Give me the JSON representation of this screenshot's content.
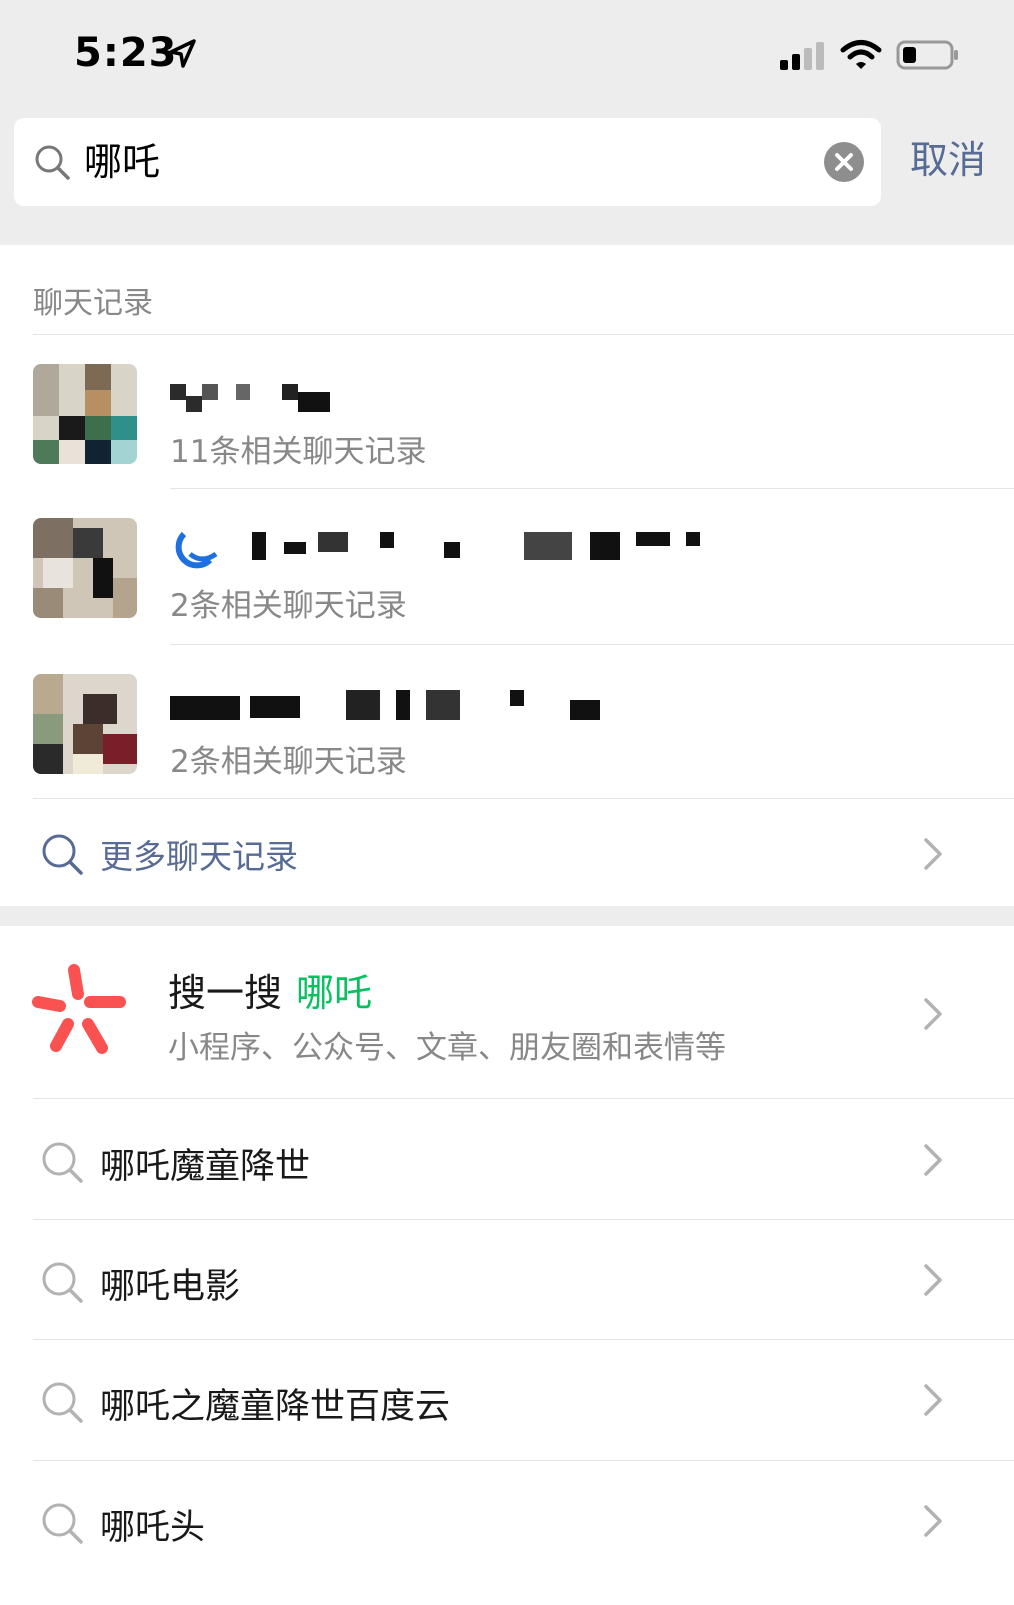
{
  "status_bar": {
    "time": "5:23"
  },
  "search": {
    "query": "哪吒",
    "cancel_label": "取消"
  },
  "chat_section": {
    "title": "聊天记录",
    "results": [
      {
        "subtitle": "11条相关聊天记录"
      },
      {
        "subtitle": "2条相关聊天记录"
      },
      {
        "subtitle": "2条相关聊天记录"
      }
    ],
    "more_label": "更多聊天记录"
  },
  "sou_yi_sou": {
    "title": "搜一搜",
    "keyword": "哪吒",
    "subtitle": "小程序、公众号、文章、朋友圈和表情等",
    "accent_color": "#07c160",
    "icon_color": "#fa5151"
  },
  "suggestions": [
    {
      "label": "哪吒魔童降世"
    },
    {
      "label": "哪吒电影"
    },
    {
      "label": "哪吒之魔童降世百度云"
    },
    {
      "label": "哪吒头"
    }
  ],
  "colors": {
    "link": "#576b95",
    "secondary_text": "#888888",
    "background_gray": "#ededed"
  }
}
